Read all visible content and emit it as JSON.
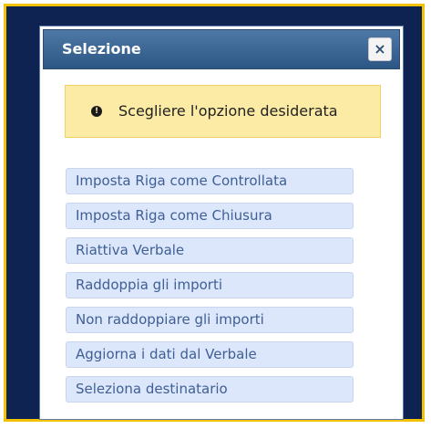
{
  "dialog": {
    "title": "Selezione",
    "close_icon": "×",
    "alert": {
      "icon": "!",
      "text": "Scegliere l'opzione desiderata"
    },
    "options": [
      "Imposta Riga come Controllata",
      "Imposta Riga come Chiusura",
      "Riattiva Verbale",
      "Raddoppia gli importi",
      "Non raddoppiare gli importi",
      "Aggiorna i dati dal Verbale",
      "Seleziona destinatario"
    ]
  },
  "colors": {
    "frame_border": "#f2c200",
    "frame_background": "#0f2352",
    "titlebar": "#3a6594",
    "alert_background": "#fbeba5",
    "option_background": "#dce7fb",
    "option_text": "#3f5f95"
  }
}
